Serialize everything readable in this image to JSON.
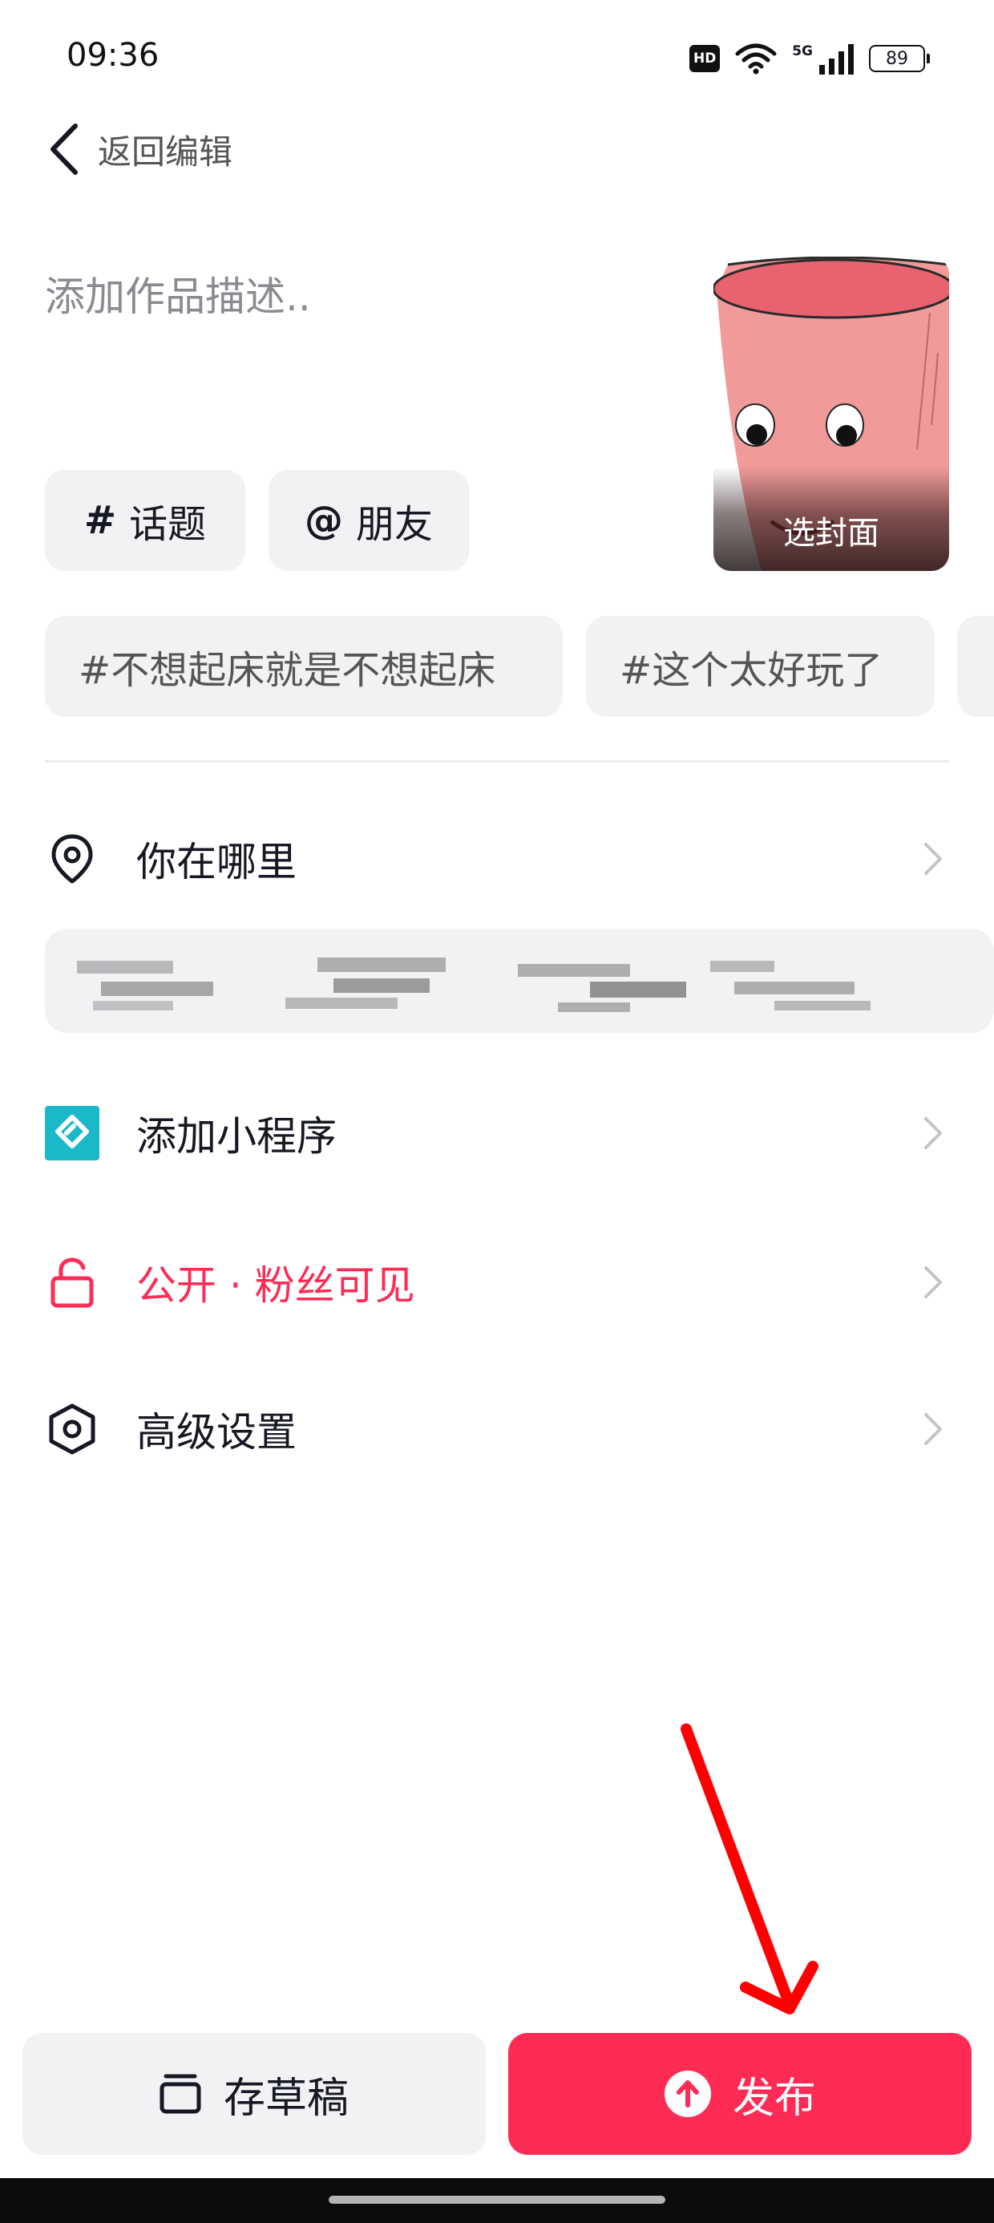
{
  "status_bar": {
    "time": "09:36",
    "hd_badge": "HD",
    "network": "5G",
    "battery": "89"
  },
  "nav": {
    "back_label": "返回编辑"
  },
  "description": {
    "placeholder": "添加作品描述.."
  },
  "cover": {
    "label": "选封面"
  },
  "chips": {
    "topic_symbol": "#",
    "topic_label": "话题",
    "friend_symbol": "@",
    "friend_label": "朋友"
  },
  "suggestions": [
    "#不想起床就是不想起床",
    "#这个太好玩了"
  ],
  "rows": {
    "location": "你在哪里",
    "mini_program": "添加小程序",
    "privacy": "公开 · 粉丝可见",
    "advanced": "高级设置"
  },
  "actions": {
    "draft": "存草稿",
    "publish": "发布"
  },
  "colors": {
    "accent": "#fe2c55",
    "mini_program_icon": "#1ab8c9",
    "annotation": "#ff0000"
  },
  "icons": {
    "back": "chevron-left-icon",
    "location": "location-pin-icon",
    "mini_program": "mini-program-icon",
    "privacy": "unlock-icon",
    "advanced": "hexagon-settings-icon",
    "chevron": "chevron-right-icon",
    "draft": "draft-box-icon",
    "publish": "upload-arrow-icon"
  }
}
